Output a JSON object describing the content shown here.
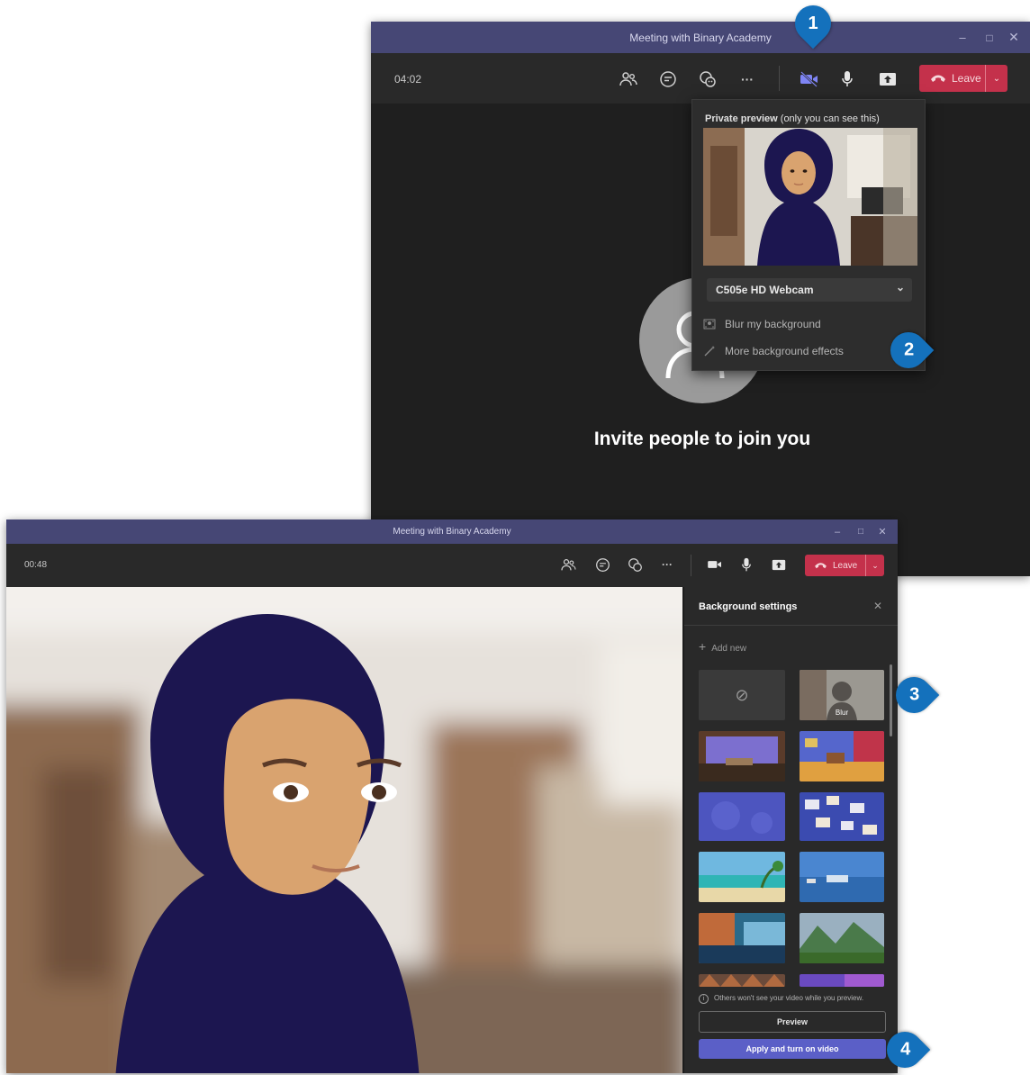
{
  "top_window": {
    "title": "Meeting with Binary Academy",
    "timer": "04:02",
    "leave_label": "Leave",
    "popup": {
      "preview_title_bold": "Private preview",
      "preview_title_rest": "(only you can see this)",
      "camera_name": "C505e HD Webcam",
      "blur_label": "Blur my background",
      "more_effects_label": "More background effects"
    },
    "invite_text": "Invite people to join you"
  },
  "bottom_window": {
    "title": "Meeting with Binary Academy",
    "timer": "00:48",
    "leave_label": "Leave",
    "panel": {
      "title": "Background settings",
      "add_new": "Add new",
      "blur_label": "Blur",
      "info_text": "Others won't see your video while you preview.",
      "preview_button": "Preview",
      "apply_button": "Apply and turn on video"
    }
  },
  "callouts": [
    "1",
    "2",
    "3",
    "4"
  ],
  "colors": {
    "title_bar": "#464775",
    "leave_red": "#c4314b",
    "apply_blue": "#5b5fc7",
    "callout_blue": "#1471bc",
    "hijab": "#1c1650",
    "skin": "#d9a36f"
  },
  "icons": [
    "people-icon",
    "chat-icon",
    "reactions-icon",
    "more-icon",
    "camera-off-icon",
    "mic-icon",
    "share-icon",
    "phone-icon",
    "chevron-down-icon",
    "blur-icon",
    "magic-wand-icon",
    "close-icon",
    "plus-icon",
    "none-icon",
    "info-icon",
    "camera-icon"
  ]
}
